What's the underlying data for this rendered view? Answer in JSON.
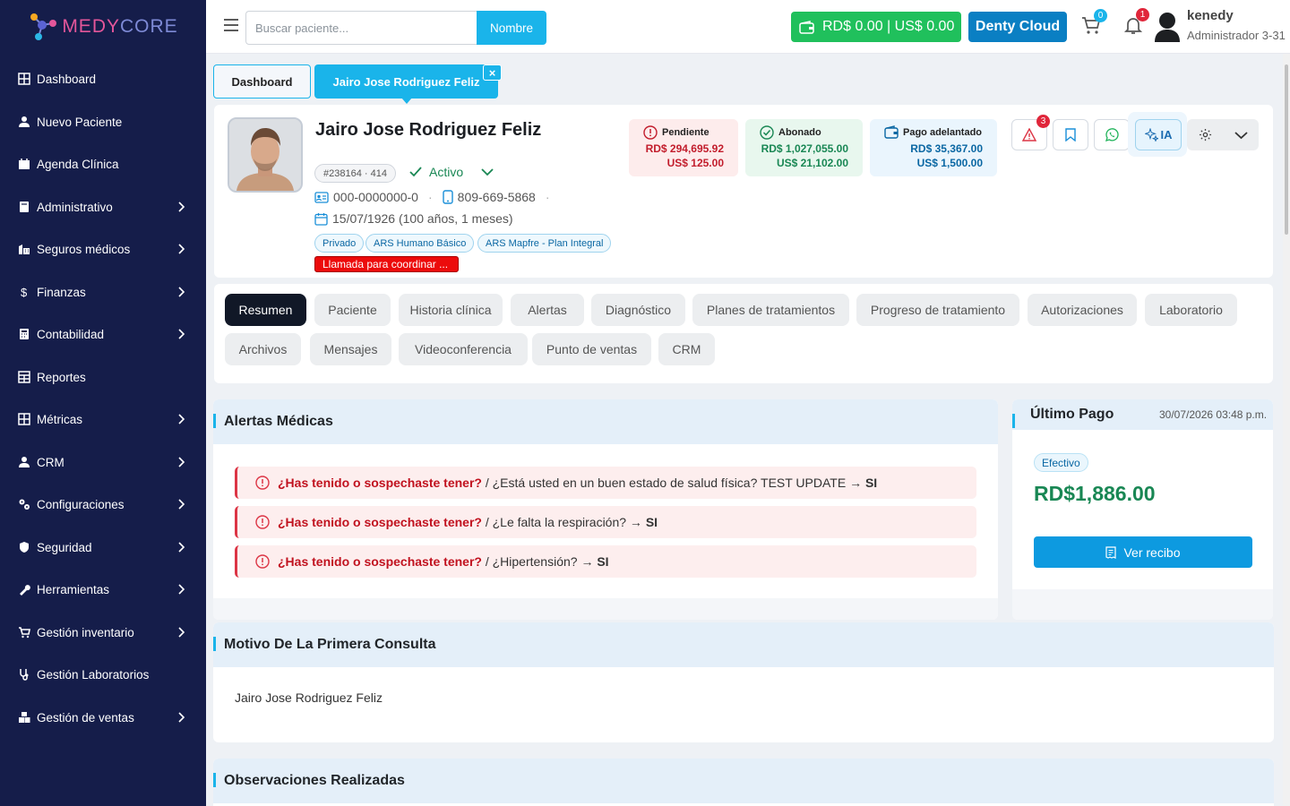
{
  "brand": {
    "name_pre": "MED",
    "name_mid": "Y",
    "name_post": "CORE"
  },
  "sidebar": {
    "items": [
      {
        "label": "Dashboard",
        "icon": "grid-icon",
        "chevron": false
      },
      {
        "label": "Nuevo Paciente",
        "icon": "user-icon",
        "chevron": false
      },
      {
        "label": "Agenda Clínica",
        "icon": "calendar-icon",
        "chevron": false
      },
      {
        "label": "Administrativo",
        "icon": "book-icon",
        "chevron": true
      },
      {
        "label": "Seguros médicos",
        "icon": "building-icon",
        "chevron": true
      },
      {
        "label": "Finanzas",
        "icon": "dollar-icon",
        "chevron": true
      },
      {
        "label": "Contabilidad",
        "icon": "calculator-icon",
        "chevron": true
      },
      {
        "label": "Reportes",
        "icon": "table-icon",
        "chevron": false
      },
      {
        "label": "Métricas",
        "icon": "grid-icon",
        "chevron": true
      },
      {
        "label": "CRM",
        "icon": "user-icon",
        "chevron": true
      },
      {
        "label": "Configuraciones",
        "icon": "gears-icon",
        "chevron": true
      },
      {
        "label": "Seguridad",
        "icon": "shield-icon",
        "chevron": true
      },
      {
        "label": "Herramientas",
        "icon": "wrench-icon",
        "chevron": true
      },
      {
        "label": "Gestión inventario",
        "icon": "cart-icon",
        "chevron": true
      },
      {
        "label": "Gestión Laboratorios",
        "icon": "stethoscope-icon",
        "chevron": false
      },
      {
        "label": "Gestión de ventas",
        "icon": "boxes-icon",
        "chevron": true
      }
    ]
  },
  "topbar": {
    "search_placeholder": "Buscar paciente...",
    "search_button": "Nombre",
    "balance": "RD$ 0.00 | US$ 0.00",
    "cloud_button": "Denty Cloud",
    "cart_count": "0",
    "notif_count": "1",
    "user_name": "kenedy",
    "user_role": "Administrador 3-31"
  },
  "tabs": {
    "dashboard": "Dashboard",
    "patient": "Jairo Jose Rodriguez Feliz",
    "close": "×"
  },
  "patient": {
    "name": "Jairo Jose Rodriguez Feliz",
    "id": "#238164 · 414",
    "status": "Activo",
    "document": "000-0000000-0",
    "phone": "809-669-5868",
    "sep": "·",
    "birth": "15/07/1926 (100 años, 1 meses)",
    "chips": [
      "Privado",
      "ARS Humano Básico",
      "ARS Mapfre - Plan Integral"
    ],
    "note": "Llamada para coordinar ..."
  },
  "finance": {
    "pending": {
      "label": "Pendiente",
      "rd": "RD$ 294,695.92",
      "us": "US$ 125.00"
    },
    "paid": {
      "label": "Abonado",
      "rd": "RD$ 1,027,055.00",
      "us": "US$ 21,102.00"
    },
    "advance": {
      "label": "Pago adelantado",
      "rd": "RD$ 35,367.00",
      "us": "US$ 1,500.00"
    }
  },
  "actions": {
    "alert_count": "3",
    "ia_label": "IA"
  },
  "profile_tabs": [
    "Resumen",
    "Paciente",
    "Historia clínica",
    "Alertas",
    "Diagnóstico",
    "Planes de tratamientos",
    "Progreso de tratamiento",
    "Autorizaciones",
    "Laboratorio",
    "Archivos",
    "Mensajes",
    "Videoconferencia",
    "Punto de ventas",
    "CRM"
  ],
  "alerts": {
    "title": "Alertas Médicas",
    "items": [
      {
        "prefix": "¿Has tenido o sospechaste tener?",
        "text": " / ¿Está usted en un buen estado de salud física? TEST UPDATE → ",
        "answer": "SI"
      },
      {
        "prefix": "¿Has tenido o sospechaste tener?",
        "text": " / ¿Le falta la respiración? → ",
        "answer": "SI"
      },
      {
        "prefix": "¿Has tenido o sospechaste tener?",
        "text": " / ¿Hipertensión? → ",
        "answer": "SI"
      }
    ]
  },
  "last_payment": {
    "title": "Último Pago",
    "date": "30/07/2026 03:48 p.m.",
    "method": "Efectivo",
    "amount": "RD$1,886.00",
    "button": "Ver recibo"
  },
  "first_visit": {
    "title": "Motivo De La Primera Consulta",
    "text": "Jairo Jose Rodriguez Feliz"
  },
  "observations": {
    "title": "Observaciones Realizadas"
  },
  "colors": {
    "sidebar": "#151d4a",
    "accent": "#1ab4ea",
    "success": "#20c05c",
    "cloud": "#0a7fc3",
    "danger": "#dc3545"
  }
}
